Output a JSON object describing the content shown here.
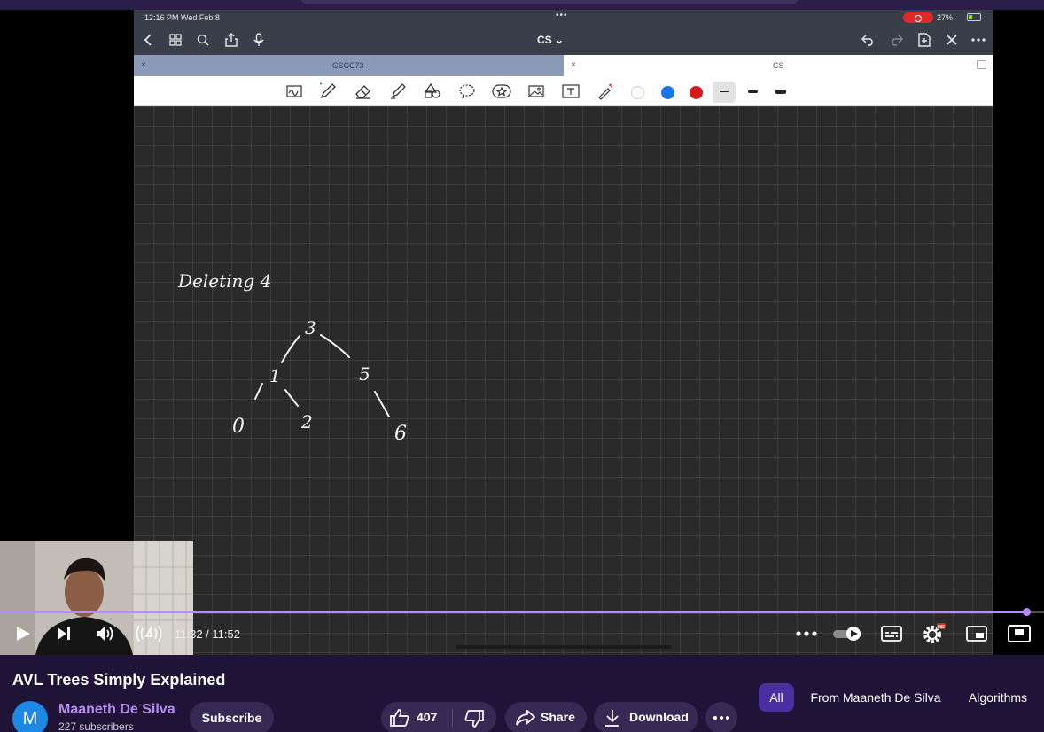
{
  "ipad": {
    "status": {
      "time": "12:16 PM  Wed Feb 8",
      "more": "•••",
      "battery": "27%"
    },
    "nav": {
      "title": "CS ⌄"
    },
    "tabs": [
      {
        "label": "CSCC73",
        "active": false
      },
      {
        "label": "CS",
        "active": true
      }
    ],
    "toolbar": {
      "tools": [
        "handwriting-icon",
        "pen-icon",
        "eraser-icon",
        "highlighter-icon",
        "shapes-icon",
        "lasso-icon",
        "sticker-icon",
        "image-icon",
        "text-icon",
        "laser-pointer-icon"
      ],
      "colors": [
        "#ffffff",
        "#1a73e8",
        "#d41b1b"
      ]
    },
    "canvas": {
      "heading": "Deleting  4",
      "nodes": [
        "3",
        "1",
        "5",
        "0",
        "2",
        "6"
      ]
    }
  },
  "player": {
    "time": "11:32 / 11:52",
    "progress": 0.983,
    "accent": "#b68cff"
  },
  "video_info": {
    "title": "AVL Trees Simply Explained",
    "channel_initial": "M",
    "channel_name": "Maaneth De Silva",
    "subscribers": "227 subscribers",
    "subscribe_label": "Subscribe",
    "like_count": "407",
    "share_label": "Share",
    "download_label": "Download",
    "more_label": "…"
  },
  "chips": [
    "All",
    "From Maaneth De Silva",
    "Algorithms"
  ]
}
